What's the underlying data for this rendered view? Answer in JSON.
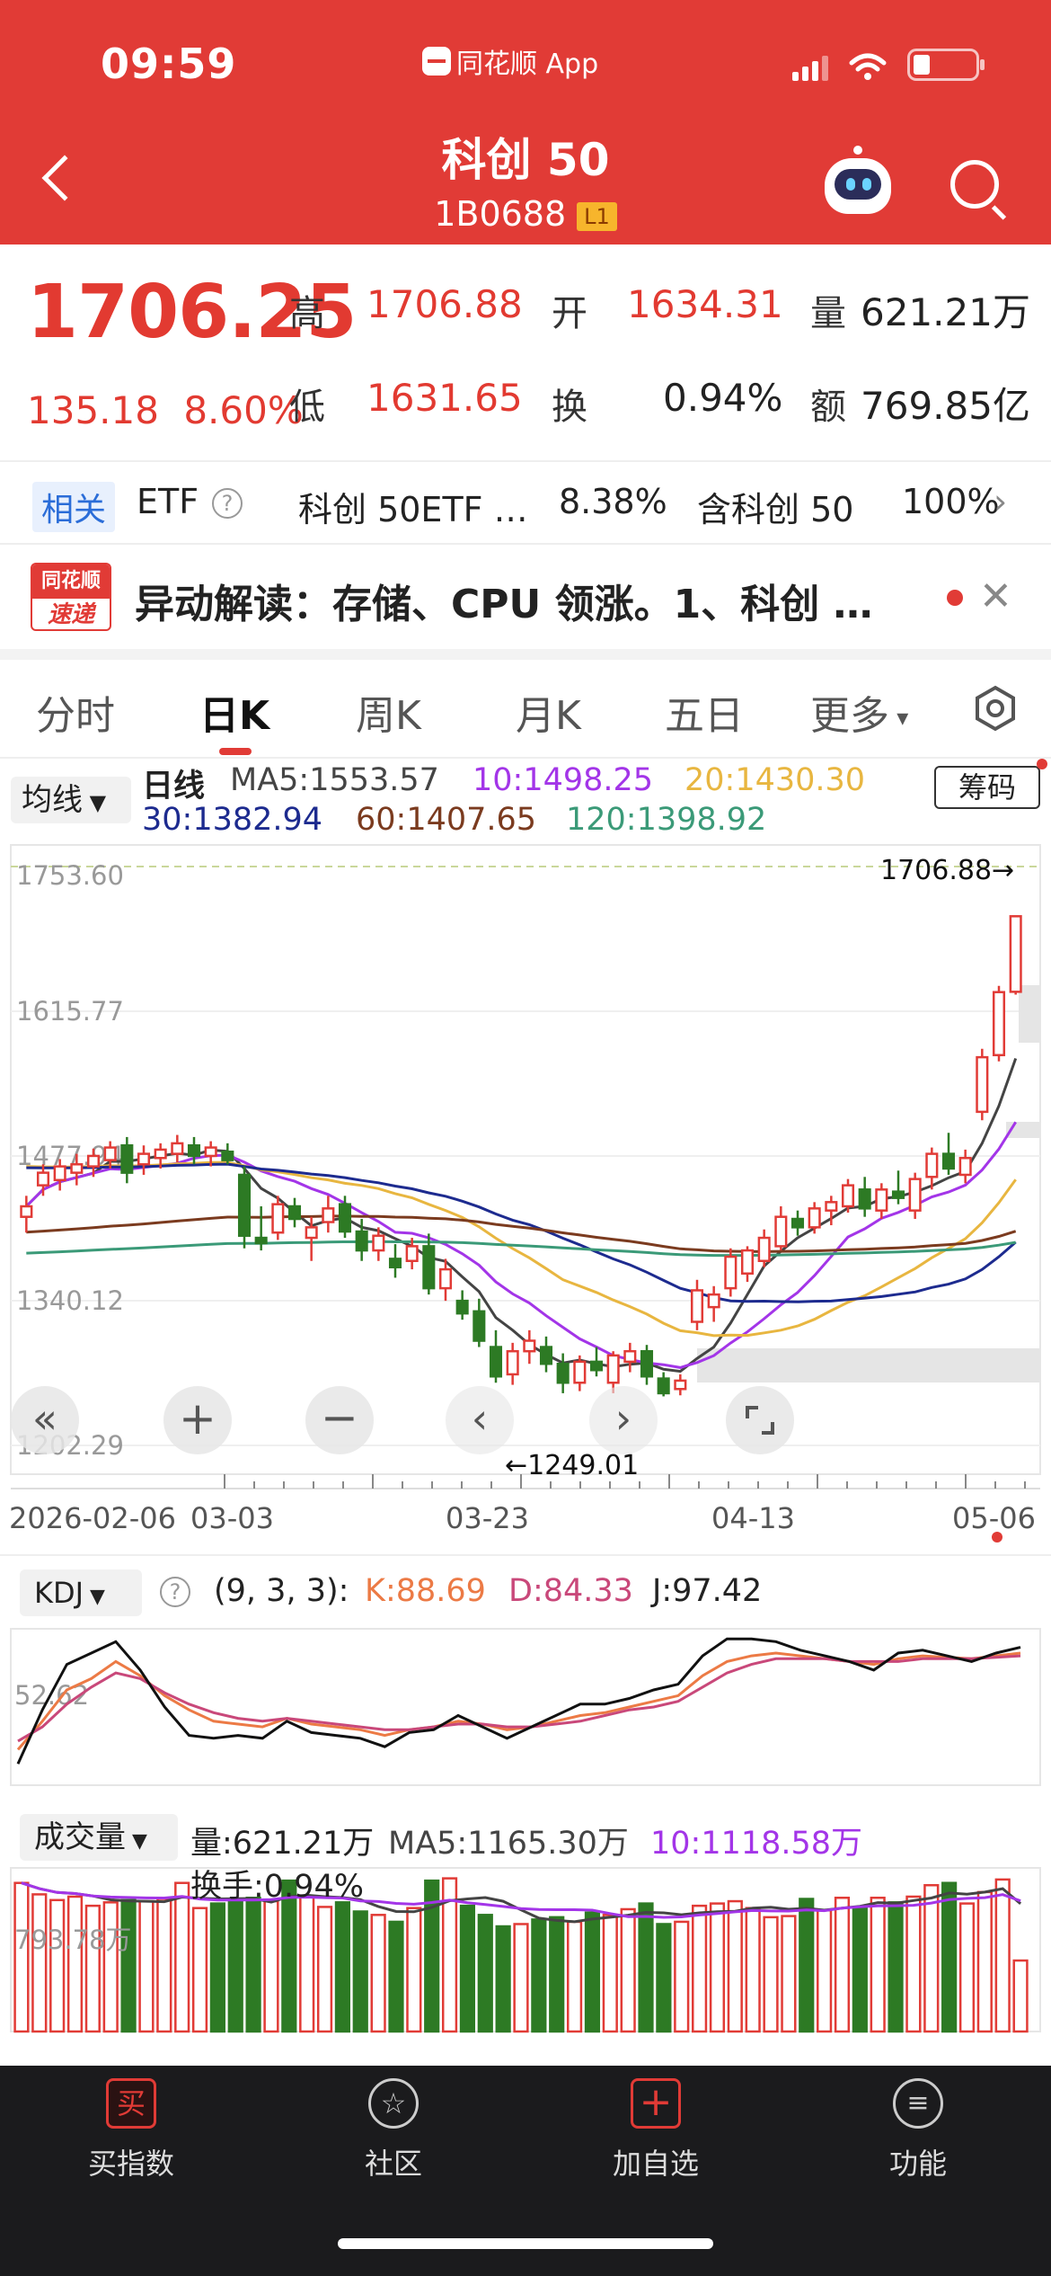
{
  "status": {
    "time": "09:59",
    "app": "同花顺 App"
  },
  "header": {
    "title": "科创 50",
    "code": "1B0688",
    "level": "L1"
  },
  "quote": {
    "price": "1706.25",
    "change": "135.18",
    "change_pct": "8.60%",
    "high_label": "高",
    "high": "1706.88",
    "open_label": "开",
    "open": "1634.31",
    "volume_label": "量",
    "volume": "621.21万",
    "low_label": "低",
    "low": "1631.65",
    "turnover_label": "换",
    "turnover": "0.94%",
    "amount_label": "额",
    "amount": "769.85亿"
  },
  "etf": {
    "tag": "相关",
    "label": "ETF",
    "name": "科创 50ETF …",
    "pct": "8.38%",
    "contain": "含科创 50",
    "contain_pct": "100%"
  },
  "news": {
    "logo_top": "同花顺",
    "logo_bottom": "速递",
    "text": "异动解读：存储、CPU 领涨。1、科创 …"
  },
  "tabs": [
    "分时",
    "日K",
    "周K",
    "月K",
    "五日",
    "更多"
  ],
  "chart_header": {
    "ma_button": "均线",
    "chip_button": "筹码",
    "line_label": "日线",
    "ma5": "MA5:1553.57",
    "ma10": "10:1498.25",
    "ma20": "20:1430.30",
    "ma30": "30:1382.94",
    "ma60": "60:1407.65",
    "ma120": "120:1398.92"
  },
  "colors": {
    "up": "#e13b36",
    "down": "#2d7a24",
    "ma5": "#444444",
    "ma10": "#a335e8",
    "ma20": "#e8b640",
    "ma30": "#1d2b8f",
    "ma60": "#7b3b1f",
    "ma120": "#3b9a78"
  },
  "chart_data": [
    {
      "type": "candlestick",
      "title": "日线",
      "y_ticks": [
        "1753.60",
        "1615.77",
        "1477.94",
        "1340.12",
        "1202.29"
      ],
      "ylim": [
        1202.29,
        1753.6
      ],
      "x_ticks": [
        "2026-02-06",
        "03-03",
        "03-23",
        "04-13",
        "05-06"
      ],
      "max_label": "1706.88→",
      "min_label": "←1249.01",
      "candles": [
        [
          1420,
          1440,
          1405,
          1430
        ],
        [
          1450,
          1470,
          1440,
          1462
        ],
        [
          1455,
          1475,
          1445,
          1468
        ],
        [
          1462,
          1480,
          1450,
          1470
        ],
        [
          1468,
          1485,
          1458,
          1478
        ],
        [
          1474,
          1492,
          1466,
          1486
        ],
        [
          1488,
          1496,
          1452,
          1462
        ],
        [
          1470,
          1488,
          1460,
          1480
        ],
        [
          1476,
          1490,
          1466,
          1484
        ],
        [
          1480,
          1498,
          1472,
          1490
        ],
        [
          1488,
          1496,
          1470,
          1478
        ],
        [
          1478,
          1492,
          1468,
          1486
        ],
        [
          1482,
          1490,
          1470,
          1474
        ],
        [
          1460,
          1468,
          1390,
          1402
        ],
        [
          1400,
          1430,
          1388,
          1395
        ],
        [
          1405,
          1440,
          1398,
          1432
        ],
        [
          1430,
          1438,
          1410,
          1418
        ],
        [
          1400,
          1420,
          1378,
          1410
        ],
        [
          1415,
          1440,
          1405,
          1428
        ],
        [
          1432,
          1440,
          1400,
          1406
        ],
        [
          1406,
          1418,
          1378,
          1388
        ],
        [
          1388,
          1410,
          1378,
          1402
        ],
        [
          1380,
          1394,
          1362,
          1372
        ],
        [
          1378,
          1400,
          1370,
          1392
        ],
        [
          1392,
          1404,
          1346,
          1352
        ],
        [
          1352,
          1380,
          1340,
          1370
        ],
        [
          1340,
          1350,
          1322,
          1328
        ],
        [
          1330,
          1342,
          1296,
          1302
        ],
        [
          1296,
          1312,
          1262,
          1268
        ],
        [
          1270,
          1300,
          1260,
          1292
        ],
        [
          1292,
          1312,
          1280,
          1302
        ],
        [
          1296,
          1306,
          1272,
          1280
        ],
        [
          1280,
          1290,
          1252,
          1262
        ],
        [
          1262,
          1288,
          1254,
          1282
        ],
        [
          1282,
          1296,
          1268,
          1274
        ],
        [
          1262,
          1292,
          1252,
          1288
        ],
        [
          1282,
          1300,
          1272,
          1292
        ],
        [
          1292,
          1298,
          1260,
          1268
        ],
        [
          1266,
          1272,
          1249,
          1252
        ],
        [
          1256,
          1270,
          1250,
          1264
        ],
        [
          1320,
          1360,
          1312,
          1350
        ],
        [
          1334,
          1354,
          1320,
          1346
        ],
        [
          1352,
          1390,
          1344,
          1382
        ],
        [
          1366,
          1392,
          1358,
          1388
        ],
        [
          1378,
          1408,
          1372,
          1400
        ],
        [
          1392,
          1430,
          1388,
          1420
        ],
        [
          1418,
          1426,
          1402,
          1410
        ],
        [
          1410,
          1434,
          1404,
          1428
        ],
        [
          1426,
          1440,
          1412,
          1434
        ],
        [
          1430,
          1456,
          1424,
          1450
        ],
        [
          1446,
          1458,
          1420,
          1428
        ],
        [
          1426,
          1452,
          1418,
          1446
        ],
        [
          1444,
          1464,
          1432,
          1438
        ],
        [
          1426,
          1462,
          1418,
          1456
        ],
        [
          1458,
          1486,
          1446,
          1480
        ],
        [
          1480,
          1500,
          1460,
          1466
        ],
        [
          1460,
          1484,
          1452,
          1476
        ],
        [
          1520,
          1580,
          1512,
          1572
        ],
        [
          1574,
          1640,
          1568,
          1634
        ],
        [
          1634.31,
          1706.88,
          1631.65,
          1706.25
        ]
      ],
      "ma_lines": [
        "MA5",
        "MA10",
        "MA20",
        "MA30",
        "MA60",
        "MA120"
      ]
    },
    {
      "type": "line",
      "title": "KDJ",
      "params": "(9, 3, 3):",
      "y_tick": "52.62",
      "series": [
        {
          "name": "K:88.69",
          "values": [
            20,
            40,
            62,
            70,
            82,
            72,
            58,
            48,
            40,
            38,
            36,
            42,
            38,
            36,
            34,
            30,
            34,
            36,
            40,
            38,
            34,
            36,
            40,
            44,
            46,
            50,
            54,
            58,
            72,
            82,
            86,
            88,
            86,
            84,
            82,
            80,
            84,
            86,
            85,
            84,
            86,
            88
          ]
        },
        {
          "name": "D:84.33",
          "values": [
            26,
            36,
            52,
            64,
            74,
            70,
            60,
            52,
            46,
            42,
            40,
            42,
            40,
            38,
            36,
            34,
            34,
            36,
            38,
            38,
            36,
            36,
            38,
            40,
            44,
            48,
            50,
            54,
            64,
            74,
            80,
            84,
            84,
            84,
            82,
            82,
            82,
            84,
            84,
            84,
            85,
            86
          ]
        },
        {
          "name": "J:97.42",
          "values": [
            10,
            48,
            80,
            88,
            96,
            76,
            50,
            30,
            28,
            30,
            28,
            40,
            32,
            30,
            28,
            22,
            32,
            34,
            44,
            36,
            28,
            36,
            44,
            52,
            52,
            56,
            62,
            66,
            86,
            98,
            98,
            96,
            90,
            86,
            82,
            76,
            88,
            90,
            86,
            82,
            88,
            92
          ]
        }
      ]
    },
    {
      "type": "bar",
      "title": "成交量",
      "y_tick": "793.78万",
      "volume_label": "量:621.21万",
      "ma5_label": "MA5:1165.30万",
      "ma10_label": "10:1118.58万",
      "turnover_label": "换手:0.94%",
      "values": [
        1300,
        1200,
        1150,
        1180,
        1100,
        1130,
        1150,
        1140,
        1160,
        1300,
        1080,
        1120,
        1150,
        1170,
        1140,
        1320,
        1180,
        1090,
        1130,
        1050,
        1020,
        960,
        1080,
        1320,
        1340,
        1100,
        1020,
        920,
        940,
        980,
        1000,
        960,
        1040,
        1020,
        1070,
        1120,
        940,
        960,
        1100,
        1120,
        1140,
        1080,
        1000,
        1010,
        1160,
        1060,
        1170,
        1080,
        1170,
        1130,
        1180,
        1280,
        1300,
        1120,
        1220,
        1330,
        621
      ]
    }
  ],
  "nav": [
    {
      "label": "买指数",
      "icon": "买"
    },
    {
      "label": "社区",
      "icon": ""
    },
    {
      "label": "加自选",
      "icon": "+"
    },
    {
      "label": "功能",
      "icon": ""
    }
  ]
}
